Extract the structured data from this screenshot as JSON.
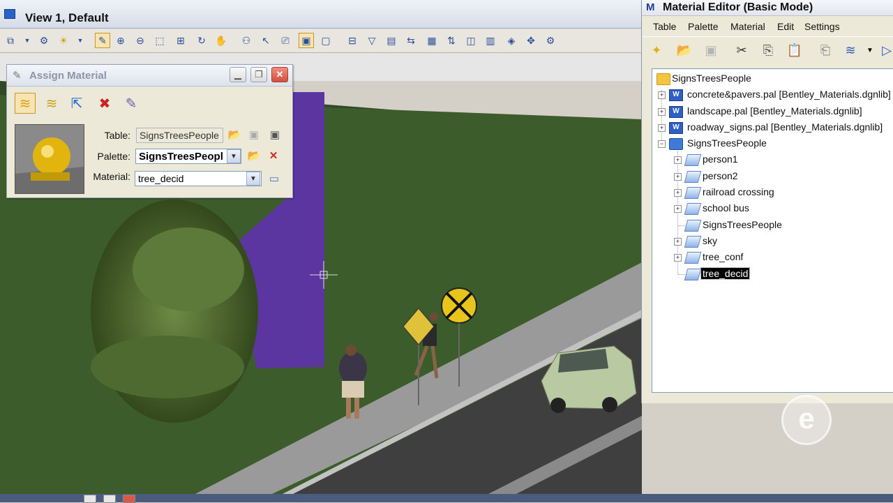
{
  "view": {
    "title": "View 1, Default"
  },
  "assign_material": {
    "title": "Assign Material",
    "table_label": "Table:",
    "table_value": "SignsTreesPeople",
    "palette_label": "Palette:",
    "palette_value": "SignsTreesPeopl",
    "material_label": "Material:",
    "material_value": "tree_decid"
  },
  "material_editor": {
    "title": "Material Editor (Basic Mode)",
    "menu": [
      "Table",
      "Palette",
      "Material",
      "Edit",
      "Settings"
    ],
    "tree": {
      "root": "SignsTreesPeople",
      "palettes": [
        "concrete&pavers.pal [Bentley_Materials.dgnlib]",
        "landscape.pal [Bentley_Materials.dgnlib]",
        "roadway_signs.pal [Bentley_Materials.dgnlib]",
        "SignsTreesPeople"
      ],
      "materials": [
        "person1",
        "person2",
        "railroad crossing",
        "school bus",
        "SignsTreesPeople",
        "sky",
        "tree_conf",
        "tree_decid"
      ],
      "selected": "tree_decid"
    }
  },
  "colors": {
    "selection": "#000000",
    "purple_panel": "#5b35a0",
    "grass": "#3a5a2a"
  }
}
